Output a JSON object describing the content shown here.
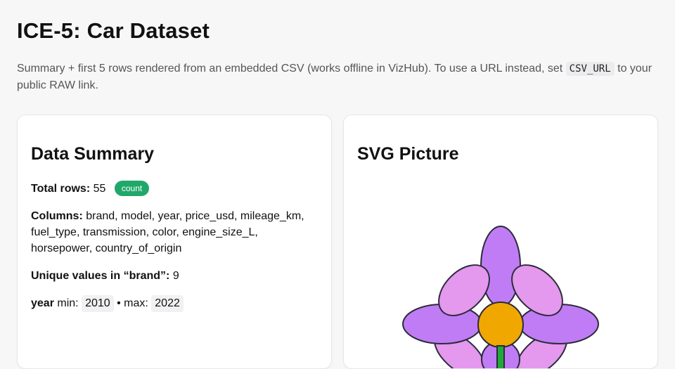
{
  "header": {
    "title": "ICE-5: Car Dataset",
    "intro_before": "Summary + first 5 rows rendered from an embedded CSV (works offline in VizHub). To use a URL instead, set ",
    "intro_code": "CSV_URL",
    "intro_after": " to your public RAW link."
  },
  "summary_card": {
    "heading": "Data Summary",
    "total_rows_label": "Total rows:",
    "total_rows_value": "55",
    "count_badge": "count",
    "columns_label": "Columns:",
    "columns_value": "brand, model, year, price_usd, mileage_km, fuel_type, transmission, color, engine_size_L, horsepower, country_of_origin",
    "unique_label": "Unique values in “brand”:",
    "unique_value": "9",
    "year_label": "year",
    "min_label": "min:",
    "min_value": "2010",
    "max_label": "• max:",
    "max_value": "2022"
  },
  "svg_card": {
    "heading": "SVG Picture",
    "colors": {
      "petal_dark": "#c07cf4",
      "petal_light": "#e498ee",
      "center": "#f0a800",
      "stem": "#22a83a",
      "outline": "#2b2b3a"
    }
  },
  "theme": {
    "badge_color": "#20a86a",
    "page_bg": "#f7f7f8"
  }
}
